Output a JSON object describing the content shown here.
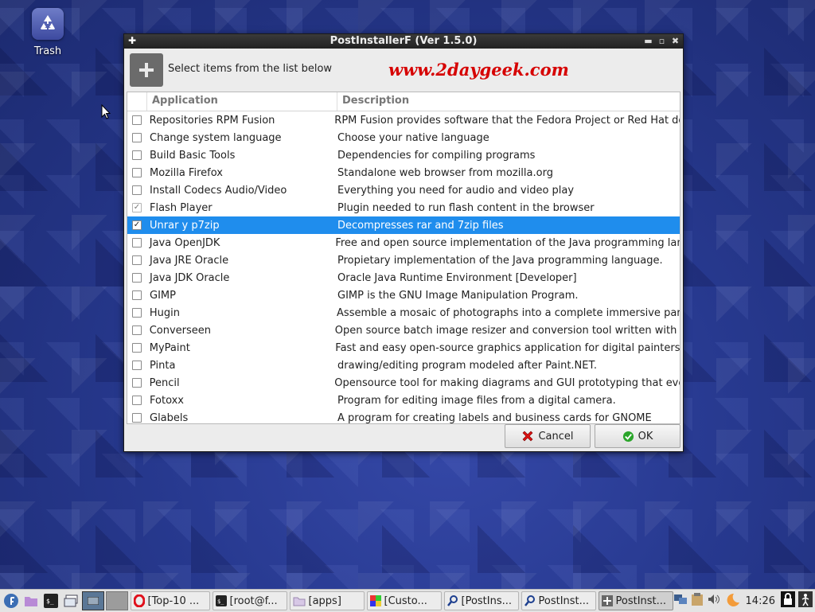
{
  "desktop": {
    "trash_label": "Trash"
  },
  "window": {
    "title": "PostInstallerF (Ver 1.5.0)",
    "prompt": "Select items from the list below",
    "watermark": "www.2daygeek.com",
    "columns": {
      "application": "Application",
      "description": "Description"
    },
    "rows": [
      {
        "app": "Repositories RPM Fusion",
        "desc": "RPM Fusion provides software that the Fedora Project or Red Hat do",
        "checked": false
      },
      {
        "app": "Change system language",
        "desc": "Choose your native language",
        "checked": false
      },
      {
        "app": "Build Basic Tools",
        "desc": "Dependencies for compiling programs",
        "checked": false
      },
      {
        "app": "Mozilla Firefox",
        "desc": "Standalone web browser from mozilla.org",
        "checked": false
      },
      {
        "app": "Install Codecs Audio/Video",
        "desc": "Everything you need for audio and video play",
        "checked": false
      },
      {
        "app": "Flash Player",
        "desc": "Plugin needed to run flash content in the browser",
        "checked": true
      },
      {
        "app": "Unrar y p7zip",
        "desc": "Decompresses rar and 7zip files",
        "checked": true,
        "selected": true
      },
      {
        "app": "Java OpenJDK",
        "desc": "Free and open source implementation of the Java programming lan",
        "checked": false
      },
      {
        "app": "Java JRE Oracle",
        "desc": "Propietary implementation of the Java programming language.",
        "checked": false
      },
      {
        "app": "Java JDK Oracle",
        "desc": "Oracle Java Runtime Environment [Developer]",
        "checked": false
      },
      {
        "app": "GIMP",
        "desc": "GIMP is the GNU Image Manipulation Program.",
        "checked": false
      },
      {
        "app": "Hugin",
        "desc": "Assemble a mosaic of photographs into a complete immersive par",
        "checked": false
      },
      {
        "app": "Converseen",
        "desc": "Open source batch image resizer and conversion tool written with (",
        "checked": false
      },
      {
        "app": "MyPaint",
        "desc": "Fast and easy open-source graphics application for digital painters.",
        "checked": false
      },
      {
        "app": "Pinta",
        "desc": "drawing/editing program modeled after Paint.NET.",
        "checked": false
      },
      {
        "app": "Pencil",
        "desc": "Opensource tool for making diagrams and GUI prototyping that eve",
        "checked": false
      },
      {
        "app": "Fotoxx",
        "desc": "Program for editing image files from a digital camera.",
        "checked": false
      },
      {
        "app": "Glabels",
        "desc": "A program for creating labels and business cards for GNOME",
        "checked": false
      }
    ],
    "buttons": {
      "cancel": "Cancel",
      "ok": "OK"
    }
  },
  "taskbar": {
    "tasks": [
      {
        "label": "[Top-10 ...",
        "icon": "opera-icon"
      },
      {
        "label": "[root@f...",
        "icon": "terminal-icon"
      },
      {
        "label": "[apps]",
        "icon": "folder-icon"
      },
      {
        "label": "[Custo...",
        "icon": "color-picker-icon"
      },
      {
        "label": "[PostIns...",
        "icon": "search-tool-icon"
      },
      {
        "label": "PostInst...",
        "icon": "search-tool-icon"
      },
      {
        "label": "PostInst...",
        "icon": "plus-icon",
        "active": true
      }
    ],
    "clock": "14:26"
  },
  "colors": {
    "selection": "#1f8ded",
    "watermark": "#d60000",
    "titlebar": "#2a2a2a"
  }
}
